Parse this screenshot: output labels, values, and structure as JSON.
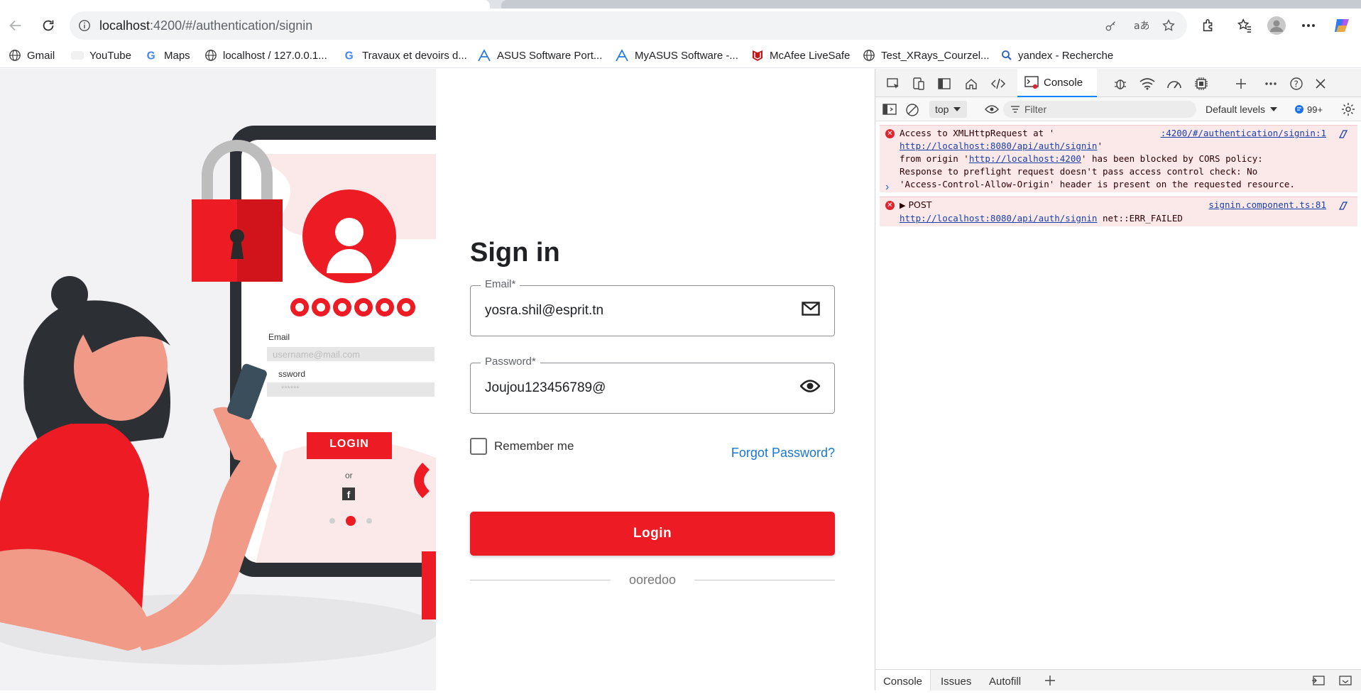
{
  "browser": {
    "url_host": "localhost",
    "url_path": ":4200/#/authentication/signin",
    "bookmarks": [
      {
        "label": "Gmail",
        "icon": "globe-icon"
      },
      {
        "label": "YouTube",
        "icon": "youtube-icon"
      },
      {
        "label": "Maps",
        "icon": "google-icon"
      },
      {
        "label": "localhost / 127.0.0.1...",
        "icon": "globe-icon"
      },
      {
        "label": "Travaux et devoirs d...",
        "icon": "google-icon"
      },
      {
        "label": "ASUS Software Port...",
        "icon": "asus-icon"
      },
      {
        "label": "MyASUS Software -...",
        "icon": "asus-icon"
      },
      {
        "label": "McAfee LiveSafe",
        "icon": "mcafee-icon"
      },
      {
        "label": "Test_XRays_Courzel...",
        "icon": "globe-icon"
      },
      {
        "label": "yandex - Recherche",
        "icon": "search-icon"
      }
    ]
  },
  "illustration": {
    "brand": "ooredoo",
    "email_label": "Email",
    "username_placeholder": "username@mail.com",
    "password_label": "ssword",
    "password_dots": "******",
    "login": "LOGIN",
    "or": "or"
  },
  "signin": {
    "title": "Sign in",
    "email_label": "Email*",
    "email_value": "yosra.shil@esprit.tn",
    "password_label": "Password*",
    "password_value": "Joujou123456789@",
    "remember_label": "Remember me",
    "forgot_label": "Forgot Password?",
    "login_label": "Login",
    "footer_brand": "ooredoo"
  },
  "devtools": {
    "console_tab": "Console",
    "context": "top",
    "filter_placeholder": "Filter",
    "levels": "Default levels",
    "issues_count": "99+",
    "messages": [
      {
        "source": ":4200/#/authentication/signin:1",
        "line1": "Access to XMLHttpRequest at '",
        "url1": "http://localhost:8080/api/auth/signin",
        "line2a": "' ",
        "line3a": "from origin '",
        "url2": "http://localhost:4200",
        "line3b": "' has been blocked by CORS policy:",
        "line4": "Response to preflight request doesn't pass access control check: No",
        "line5": "'Access-Control-Allow-Origin' header is present on the requested resource."
      },
      {
        "source": "signin.component.ts:81",
        "method": "POST",
        "url": "http://localhost:8080/api/auth/signin",
        "status": "net::ERR_FAILED"
      }
    ],
    "bottom_tabs": [
      "Console",
      "Issues",
      "Autofill"
    ]
  },
  "colors": {
    "brand_red": "#ed1c24",
    "link_blue": "#1976d2"
  }
}
